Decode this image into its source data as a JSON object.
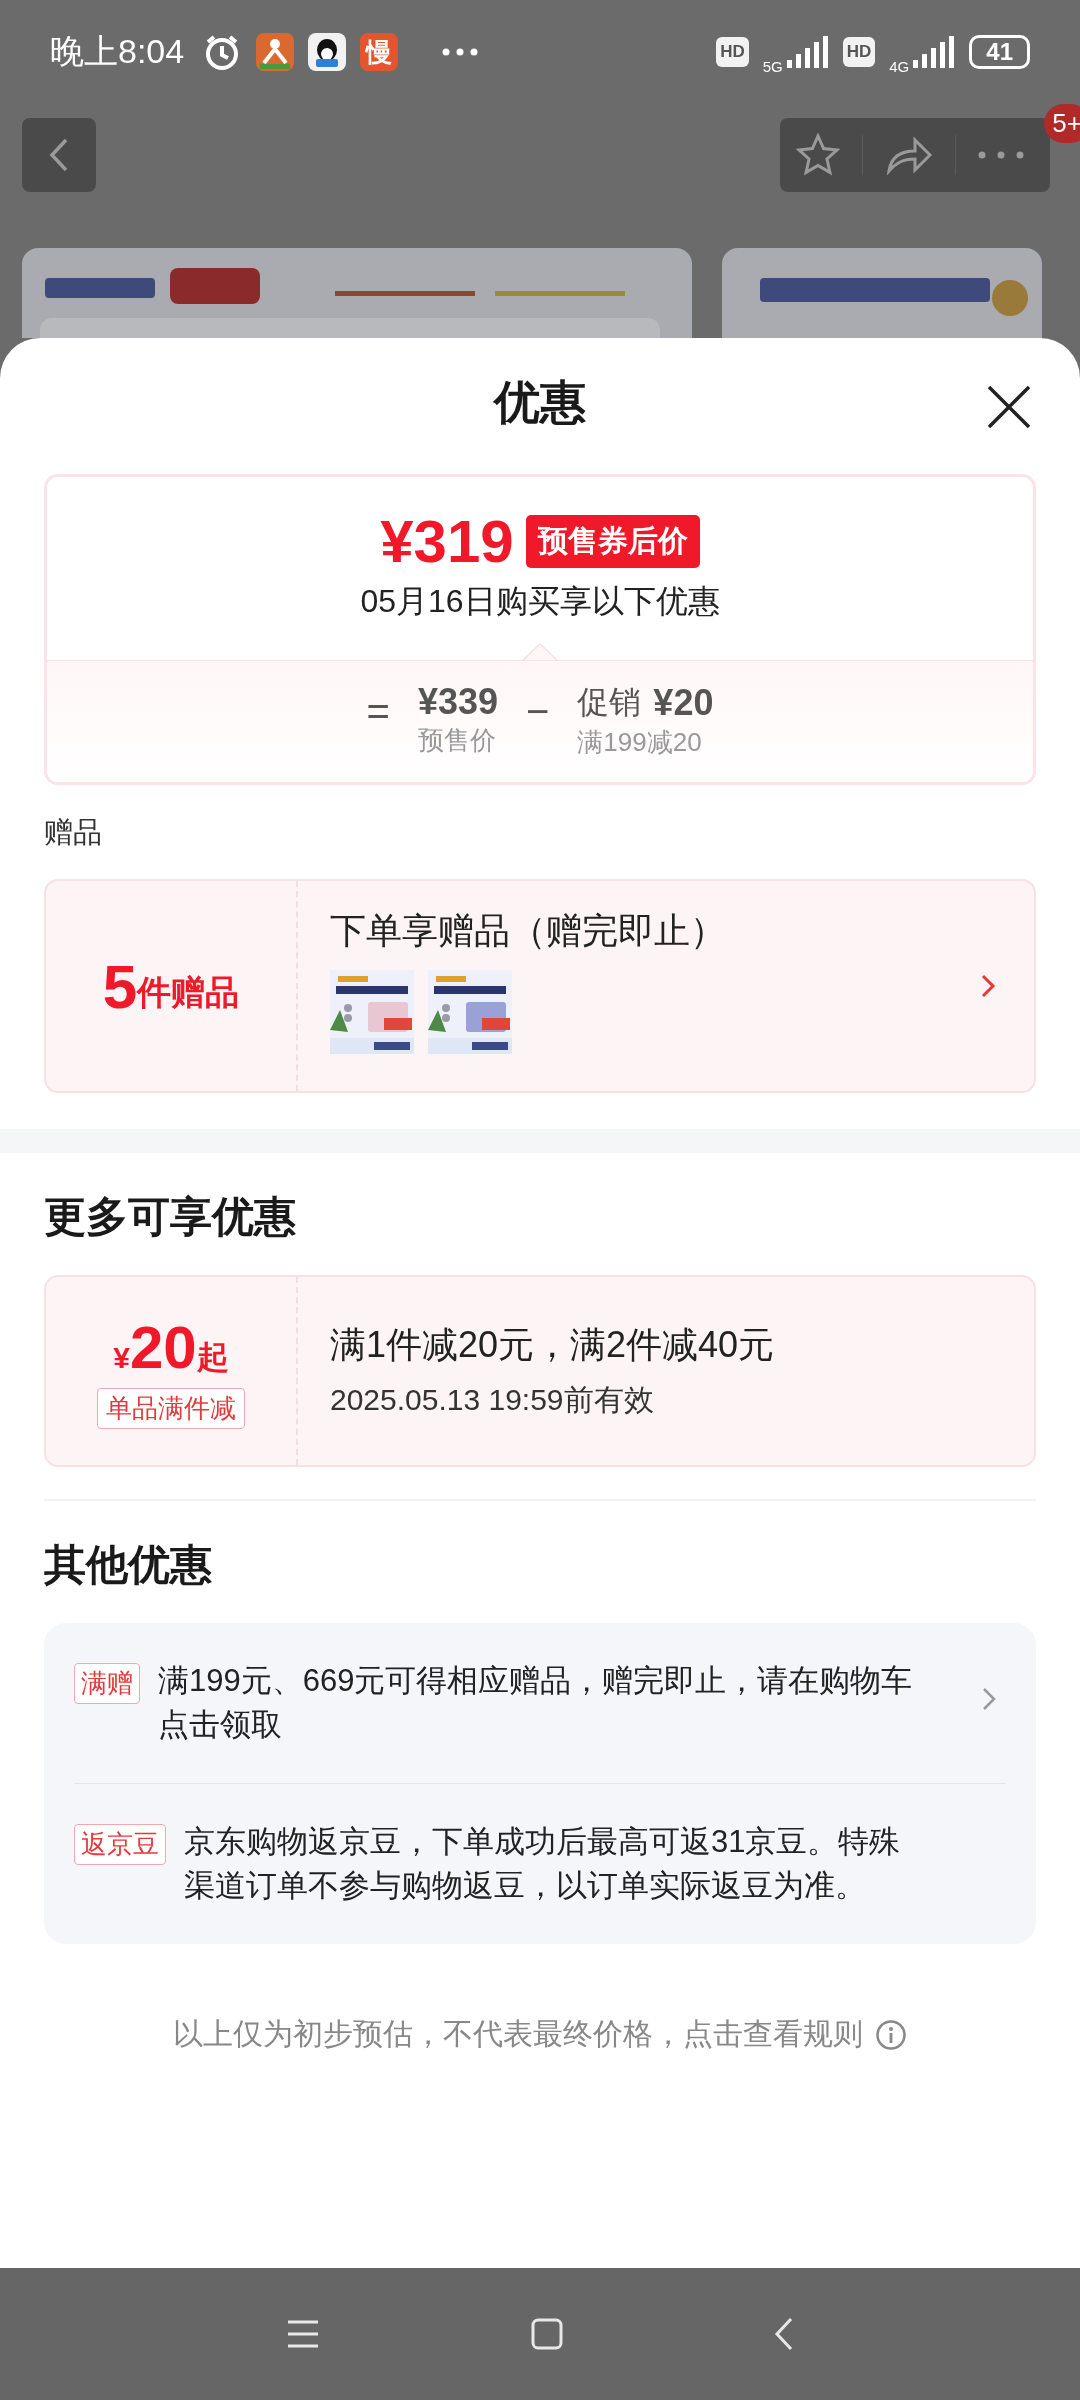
{
  "status_bar": {
    "time": "晚上8:04",
    "app_icon_text": "慢",
    "network_1": "HD",
    "signal_1": "5G",
    "network_2": "HD",
    "signal_2": "4G",
    "battery": "41"
  },
  "top_nav": {
    "badge": "5+"
  },
  "sheet": {
    "title": "优惠"
  },
  "price_card": {
    "price": "¥319",
    "price_tag": "预售券后价",
    "subtitle": "05月16日购买享以下优惠",
    "equals": "=",
    "presale_price": "¥339",
    "presale_label": "预售价",
    "minus": "−",
    "promo_label": "促销",
    "promo_amount": "¥20",
    "promo_rule": "满199减20"
  },
  "gifts": {
    "section_title": "赠品",
    "count": "5",
    "count_unit": "件赠品",
    "title": "下单享赠品（赠完即止）"
  },
  "more_offers": {
    "title": "更多可享优惠",
    "currency": "¥",
    "amount": "20",
    "amount_suffix": "起",
    "tag": "单品满件减",
    "rule": "满1件减20元，满2件减40元",
    "valid_until": "2025.05.13 19:59前有效"
  },
  "other_offers": {
    "title": "其他优惠",
    "items": [
      {
        "tag": "满赠",
        "text": "满199元、669元可得相应赠品，赠完即止，请在购物车点击领取",
        "has_arrow": true
      },
      {
        "tag": "返京豆",
        "text": "京东购物返京豆，下单成功后最高可返31京豆。特殊渠道订单不参与购物返豆，以订单实际返豆为准。",
        "has_arrow": false
      }
    ]
  },
  "footer_note": "以上仅为初步预估，不代表最终价格，点击查看规则"
}
